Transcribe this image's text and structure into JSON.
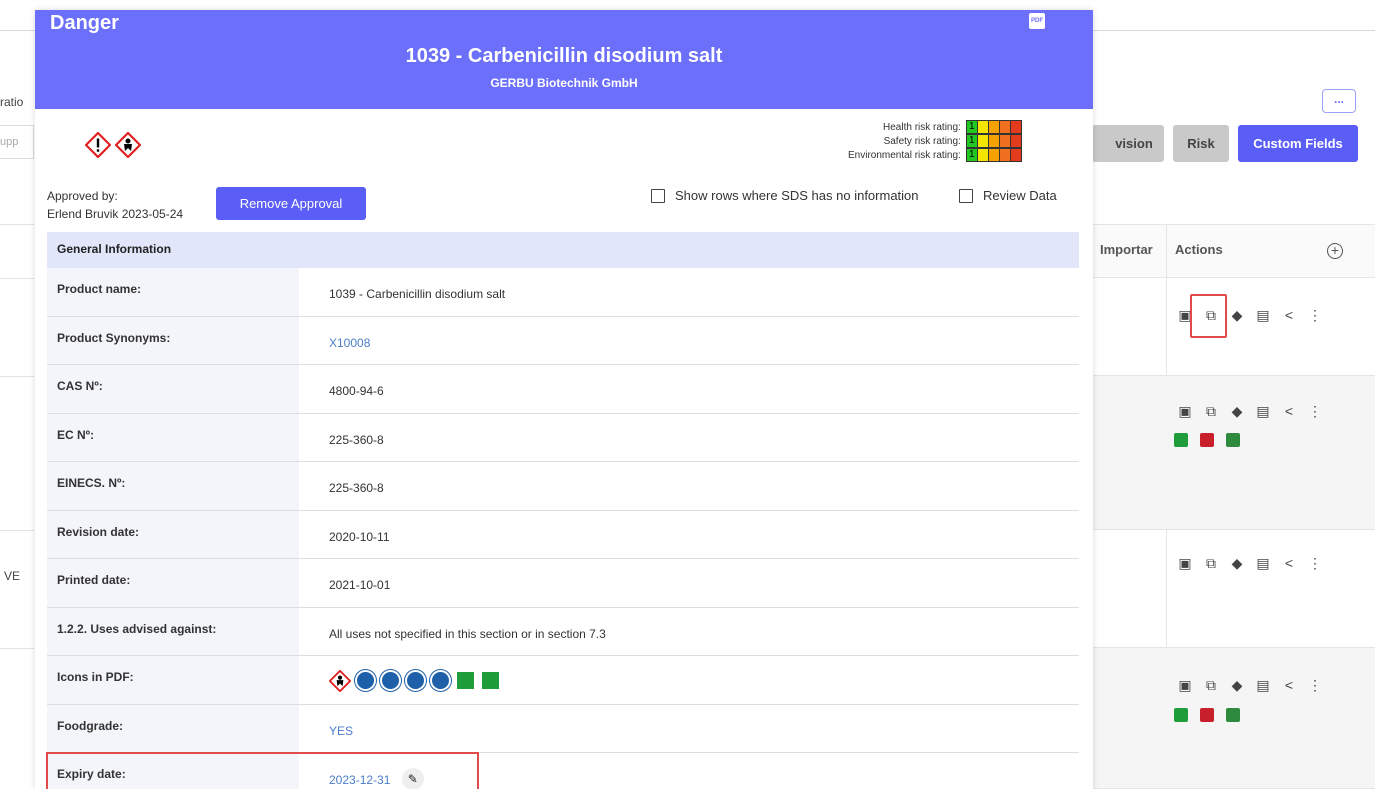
{
  "background": {
    "left_label": "ratio",
    "left_input_placeholder": "upp",
    "left_row_text": "VE",
    "more_button": "...",
    "buttons": [
      "vision",
      "Risk",
      "Custom Fields"
    ],
    "col_importance": "Importar",
    "col_actions": "Actions",
    "add_column": "+"
  },
  "modal": {
    "signal_word": "Danger",
    "title": "1039 - Carbenicillin disodium salt",
    "supplier": "GERBU Biotechnik GmbH",
    "pdf_icon_label": "PDF",
    "risk": {
      "rows": [
        {
          "label": "Health risk rating:",
          "value": "1"
        },
        {
          "label": "Safety risk rating:",
          "value": "1"
        },
        {
          "label": "Environmental risk rating:",
          "value": "1"
        }
      ],
      "colors": [
        "#22c822",
        "#f4e600",
        "#f5a100",
        "#f07020",
        "#e33b1c"
      ]
    },
    "approved_by_label": "Approved by:",
    "approved_by_value": "Erlend Bruvik 2023-05-24",
    "remove_approval": "Remove Approval",
    "show_rows_label": "Show rows where SDS has no information",
    "review_data_label": "Review Data",
    "section_title": "General Information",
    "rows": [
      {
        "key": "Product name:",
        "value": "1039 - Carbenicillin disodium salt"
      },
      {
        "key": "Product Synonyms:",
        "value": "X10008"
      },
      {
        "key": "CAS Nº:",
        "value": "4800-94-6"
      },
      {
        "key": "EC Nº:",
        "value": "225-360-8"
      },
      {
        "key": "EINECS. Nº:",
        "value": "225-360-8"
      },
      {
        "key": "Revision date:",
        "value": "2020-10-11"
      },
      {
        "key": "Printed date:",
        "value": "2021-10-01"
      },
      {
        "key": "1.2.2. Uses advised against:",
        "value": "All uses not specified in this section or in section 7.3"
      },
      {
        "key": "Icons in PDF:",
        "value": ""
      },
      {
        "key": "Foodgrade:",
        "value": "YES"
      },
      {
        "key": "Expiry date:",
        "value": "2023-12-31"
      }
    ]
  }
}
